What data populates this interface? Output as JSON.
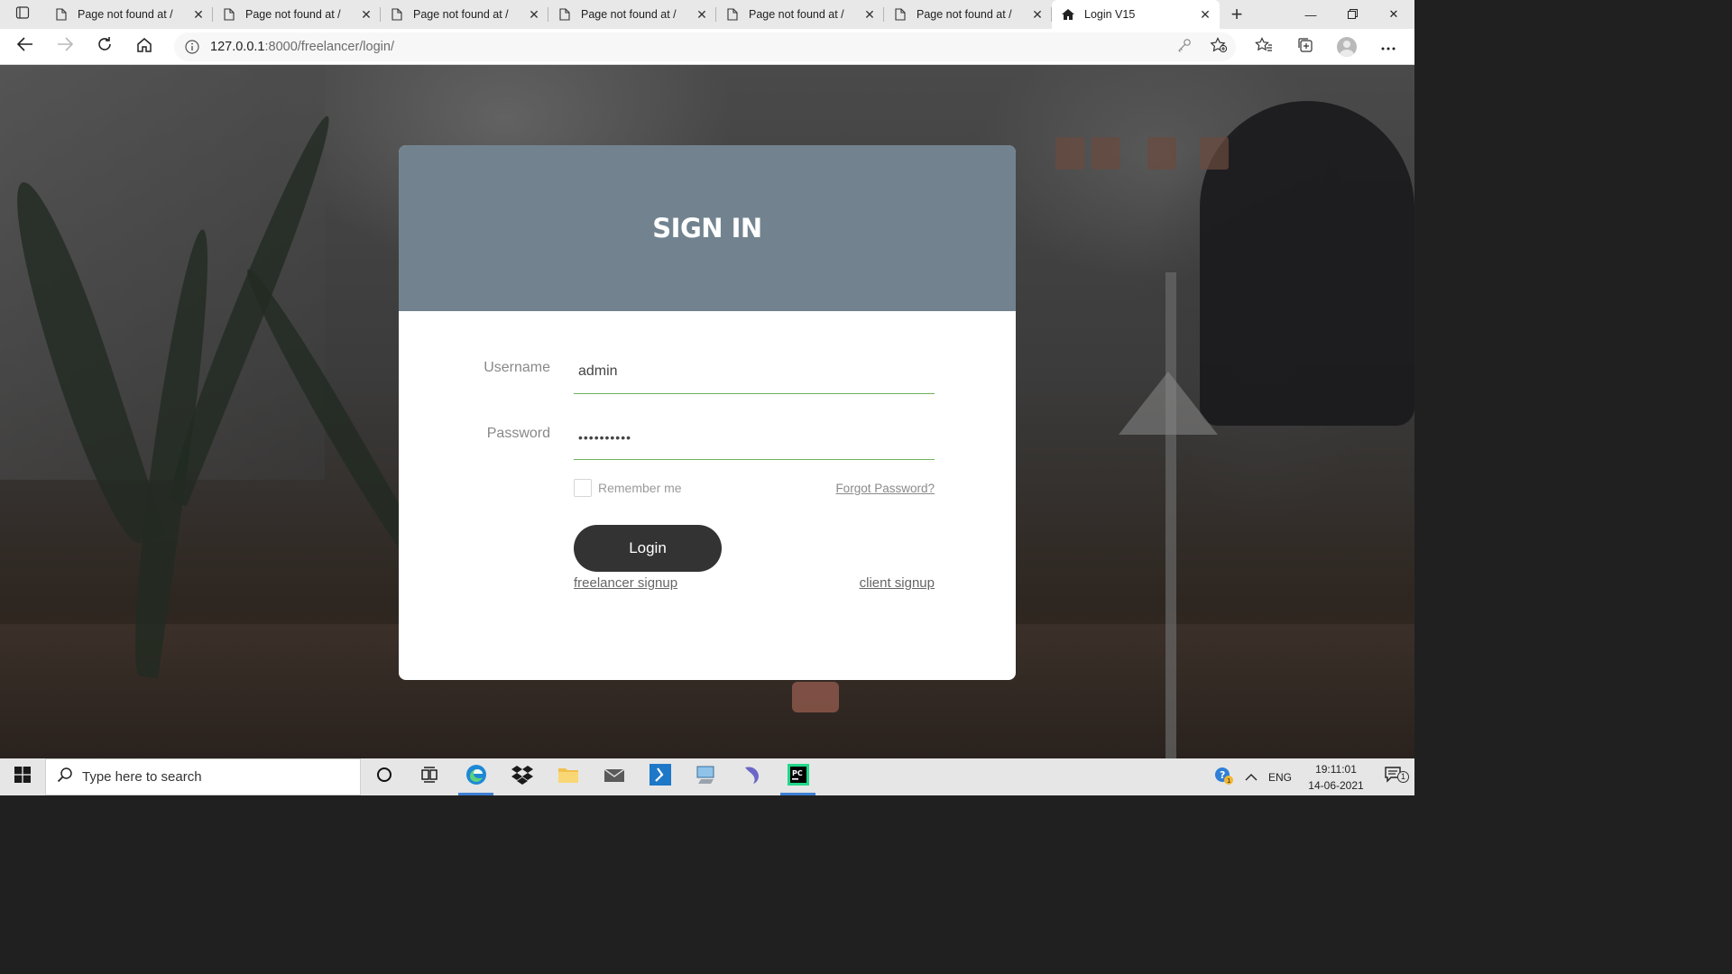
{
  "browser": {
    "tabs": [
      {
        "title": "Page not found at /",
        "active": false
      },
      {
        "title": "Page not found at /",
        "active": false
      },
      {
        "title": "Page not found at /",
        "active": false
      },
      {
        "title": "Page not found at /",
        "active": false
      },
      {
        "title": "Page not found at /",
        "active": false
      },
      {
        "title": "Page not found at /",
        "active": false
      },
      {
        "title": "Login V15",
        "active": true
      }
    ],
    "url_host": "127.0.0.1",
    "url_rest": ":8000/freelancer/login/"
  },
  "login": {
    "heading": "SIGN IN",
    "username_label": "Username",
    "username_value": "admin",
    "password_label": "Password",
    "password_value": "••••••••••",
    "remember_label": "Remember me",
    "forgot_link": "Forgot Password?",
    "login_button": "Login",
    "freelancer_signup": "freelancer signup",
    "client_signup": "client signup",
    "header_color": "#72838f",
    "input_underline_color": "#6cb35c"
  },
  "taskbar": {
    "search_placeholder": "Type here to search",
    "language": "ENG",
    "time": "19:11:01",
    "date": "14-06-2021",
    "notification_count": "1",
    "apps": [
      "cortana-icon",
      "task-view-icon",
      "edge-icon",
      "dropbox-icon",
      "file-explorer-icon",
      "mail-icon",
      "powershell-icon",
      "remote-desktop-icon",
      "dolphin-icon",
      "pycharm-icon"
    ]
  }
}
